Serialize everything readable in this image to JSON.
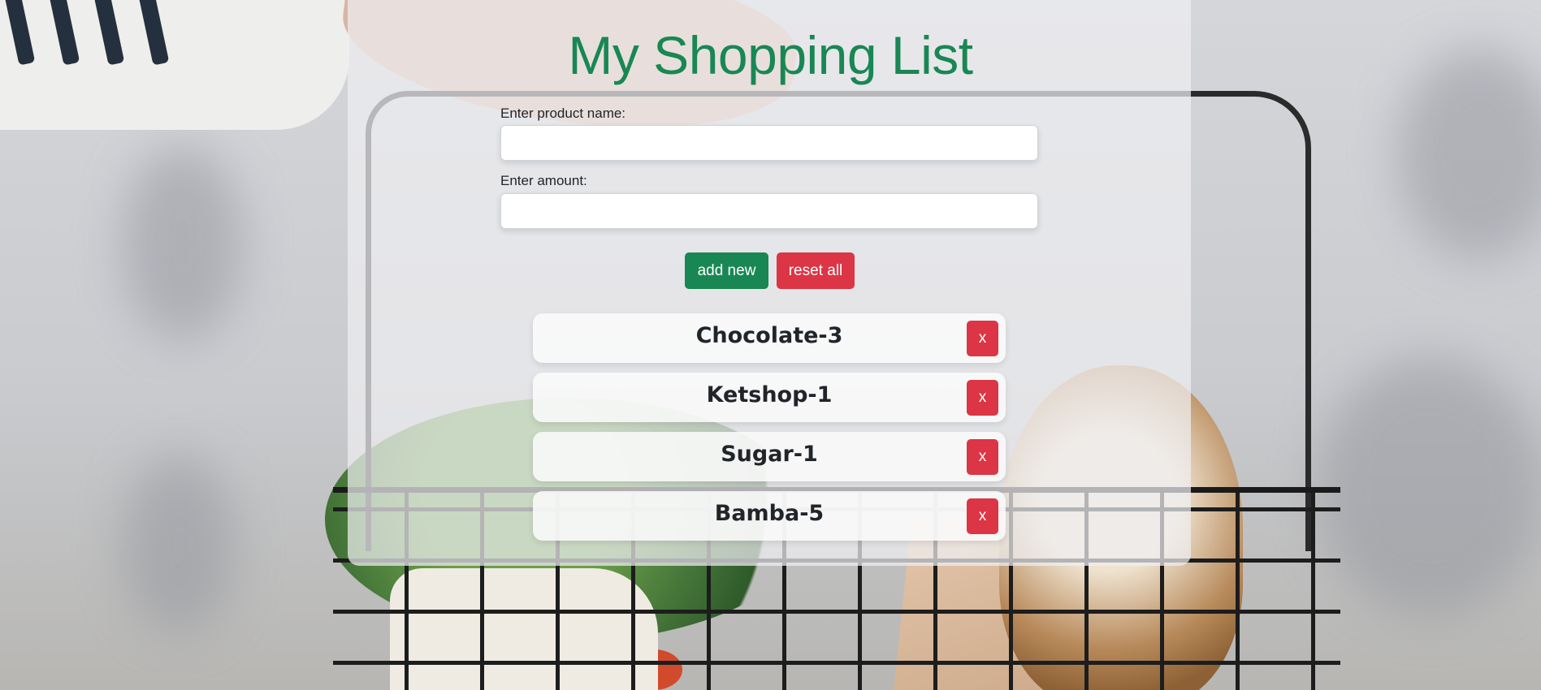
{
  "header": {
    "title": "My Shopping List"
  },
  "form": {
    "product_label": "Enter product name:",
    "product_value": "",
    "amount_label": "Enter amount:",
    "amount_value": ""
  },
  "buttons": {
    "add_label": "add new",
    "reset_label": "reset all"
  },
  "list": {
    "delete_label": "x",
    "items": [
      {
        "label": "Chocolate-3"
      },
      {
        "label": "Ketshop-1"
      },
      {
        "label": "Sugar-1"
      },
      {
        "label": "Bamba-5"
      }
    ]
  },
  "colors": {
    "title": "#198754",
    "primary_button": "#198754",
    "danger_button": "#dc3545"
  },
  "background": {
    "description_icon": "shopping-basket-photo"
  }
}
